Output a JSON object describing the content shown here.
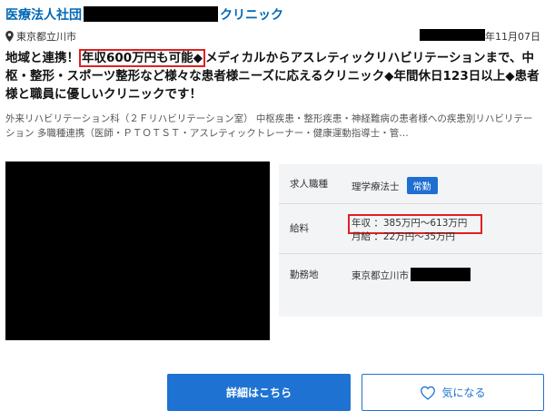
{
  "listing": {
    "title_prefix": "医療法人社団",
    "title_suffix": "クリニック",
    "location": "東京都立川市",
    "date_suffix": "年11月07日",
    "headline_pre": "地域と連携！",
    "headline_highlight": "年収600万円も可能◆",
    "headline_rest": "メディカルからアスレティックリハビリテーションまで、中枢・整形・スポーツ整形など様々な患者様ニーズに応えるクリニック◆年間休日123日以上◆患者様と職員に優しいクリニックです！",
    "description": "外来リハビリテーション科（２Ｆリハビリテーション室） 中枢疾患・整形疾患・神経難病の患者様への疾患別リハビリテーション 多職種連携（医師・ＰＴＯＴＳＴ・アスレティックトレーナー・健康運動指導士・管…"
  },
  "info": {
    "job_type_label": "求人職種",
    "job_type_value": "理学療法士",
    "employment_badge": "常勤",
    "salary_label": "給料",
    "salary_annual": "年収 ：385万円～613万円",
    "salary_monthly": "月給 ：22万円～35万円",
    "workplace_label": "勤務地",
    "workplace_value": "東京都立川市"
  },
  "actions": {
    "details_button": "詳細はこちら",
    "favorite_button": "気になる",
    "favorite_icon": "heart-icon"
  },
  "colors": {
    "accent_blue": "#1e73d2",
    "title_blue": "#0068b7",
    "highlight_red": "#e02020"
  }
}
